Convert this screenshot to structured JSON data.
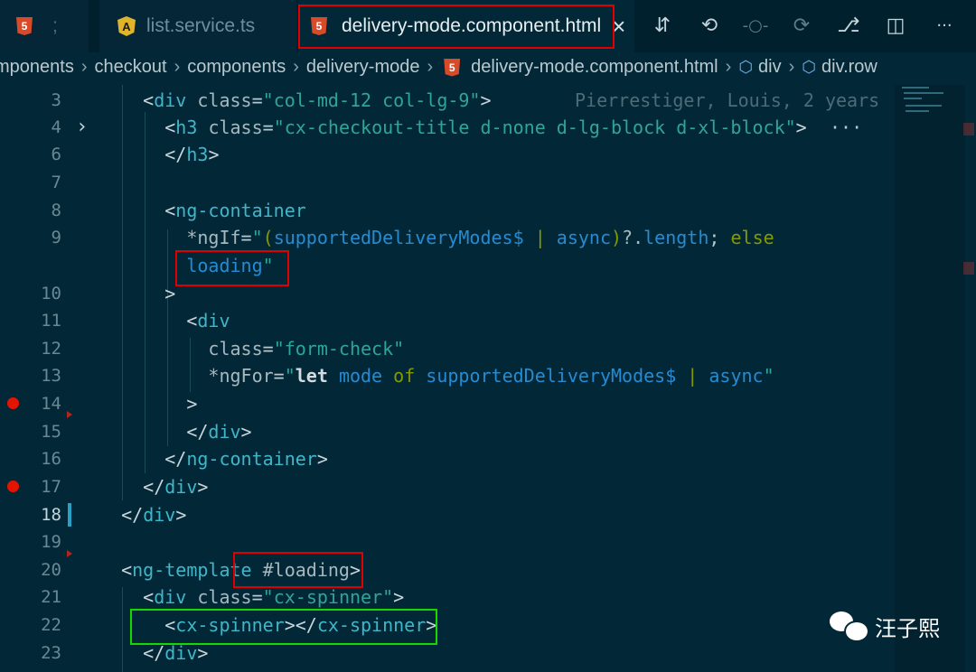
{
  "tabs": [
    {
      "label": ";",
      "icon": "html5-icon",
      "active": false
    },
    {
      "label": "list.service.ts",
      "icon": "angular-icon",
      "active": false
    },
    {
      "label": "delivery-mode.component.html",
      "icon": "html5-icon",
      "active": true,
      "close": "×"
    }
  ],
  "toolbar": {
    "icons": [
      "git-compare-icon",
      "go-back-icon",
      "commit-icon",
      "go-forward-icon",
      "git-lens-icon",
      "split-editor-icon",
      "more-actions-icon"
    ],
    "glyphs": [
      "⇵",
      "⟲",
      "-○-",
      "⟳",
      "⎇",
      "◫",
      "···"
    ]
  },
  "breadcrumb": {
    "items": [
      "mponents",
      "checkout",
      "components",
      "delivery-mode",
      "delivery-mode.component.html",
      "div",
      "div.row"
    ],
    "separator": "›",
    "file_icon_text": "5"
  },
  "editor": {
    "line_numbers": [
      "3",
      "4",
      "6",
      "7",
      "8",
      "9",
      "",
      "10",
      "11",
      "12",
      "13",
      "14",
      "15",
      "16",
      "17",
      "18",
      "19",
      "20",
      "21",
      "22",
      "23"
    ],
    "blame": "Pierrestiger, Louis, 2 years",
    "fold_glyph": "›",
    "ellipsis": "···"
  },
  "watermark": {
    "text": "汪子熙",
    "icon": "wechat-icon"
  }
}
